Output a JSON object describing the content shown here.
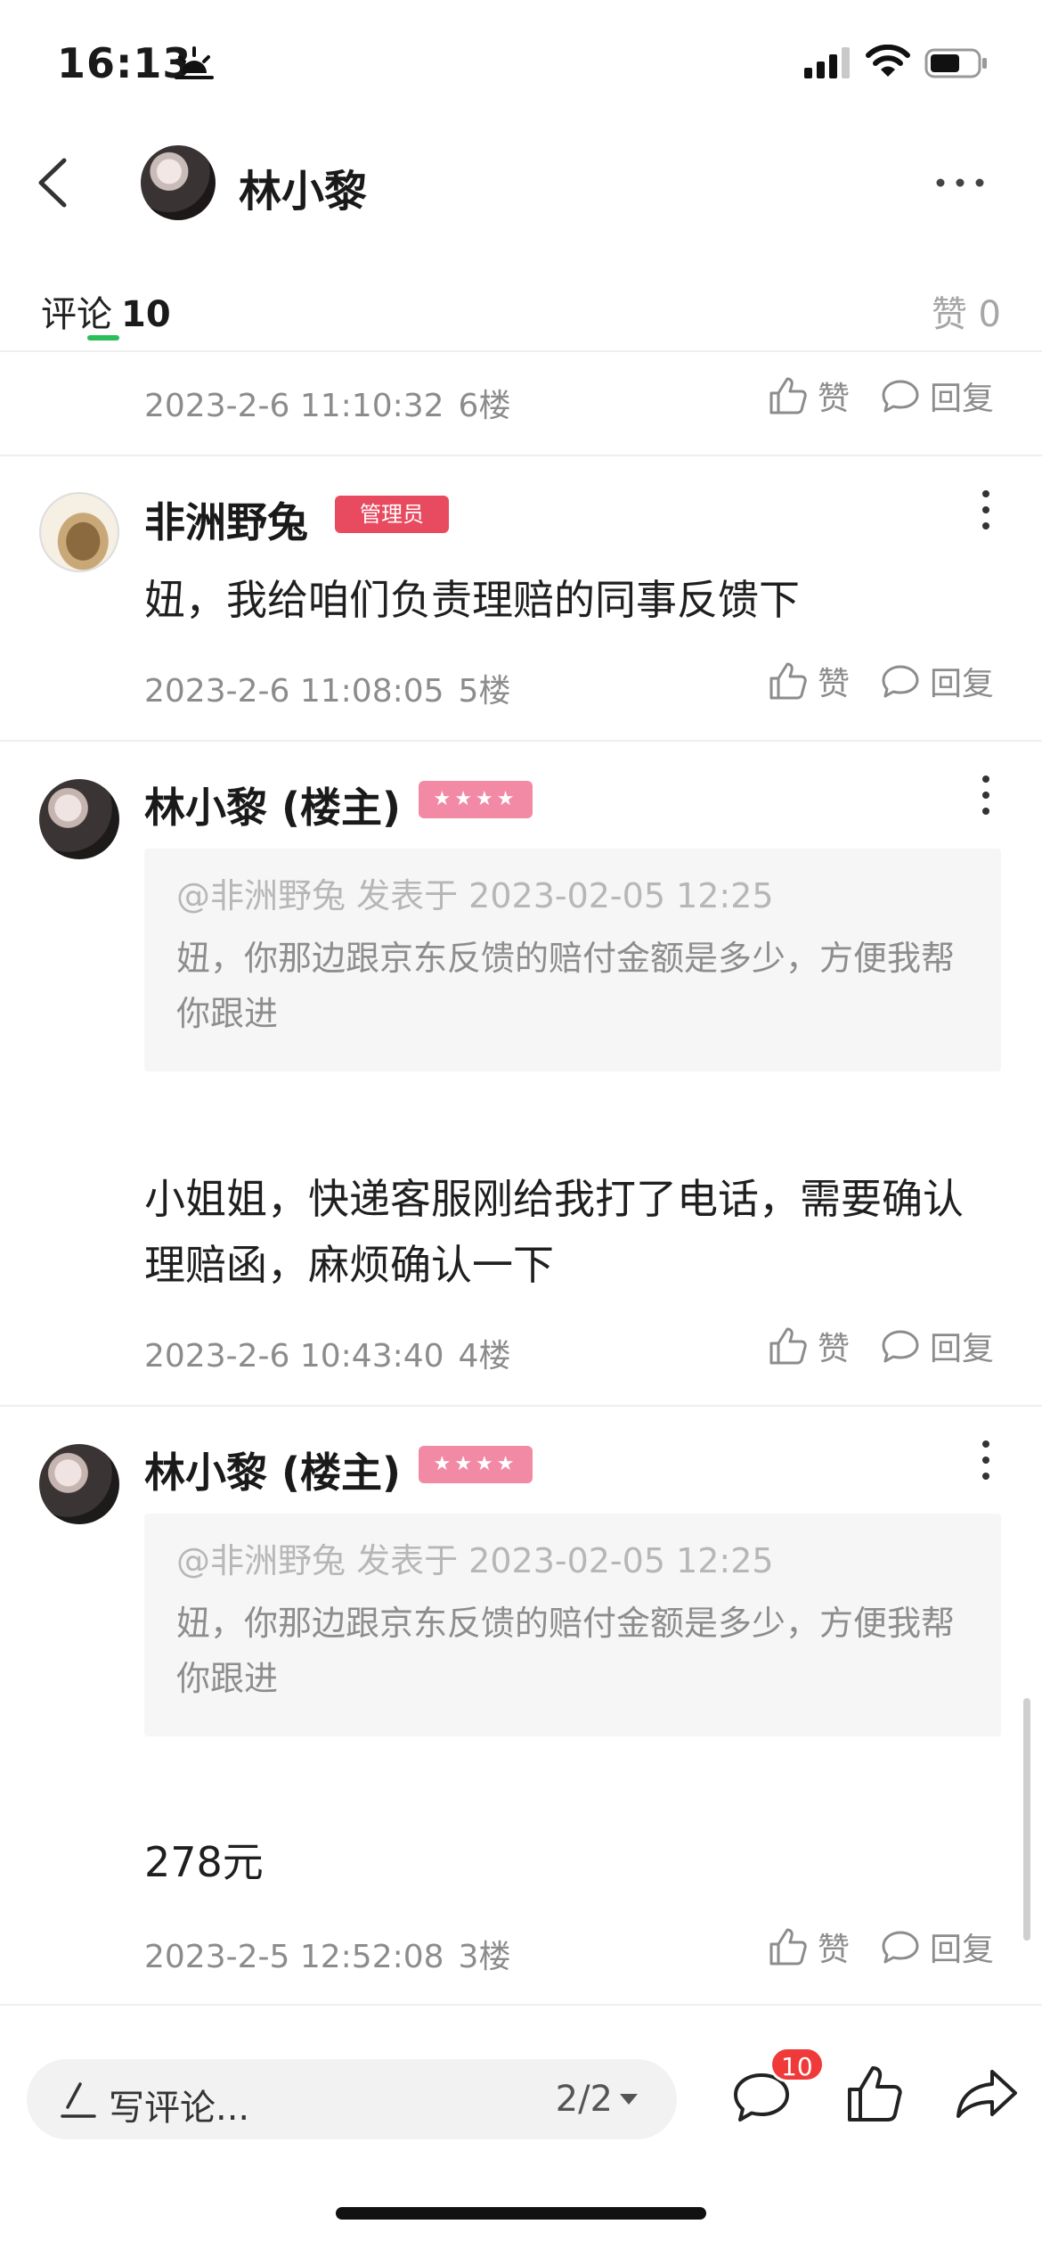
{
  "status_bar": {
    "time": "16:13"
  },
  "header": {
    "title": "林小黎"
  },
  "tabs": {
    "comments_label": "评论",
    "comments_count": "10",
    "likes_label": "赞 0"
  },
  "actions": {
    "like": "赞",
    "reply": "回复"
  },
  "comments": [
    {
      "time": "2023-2-6 11:10:32",
      "floor": "6楼"
    },
    {
      "author": "非洲野兔",
      "badge": "管理员",
      "text": "妞，我给咱们负责理赔的同事反馈下",
      "time": "2023-2-6 11:08:05",
      "floor": "5楼"
    },
    {
      "author": "林小黎 (楼主)",
      "badge": "★★★★",
      "quote_head": "@非洲野兔 发表于 2023-02-05 12:25",
      "quote_body": "妞，你那边跟京东反馈的赔付金额是多少，方便我帮你跟进",
      "text": "小姐姐，快递客服刚给我打了电话，需要确认理赔函，麻烦确认一下",
      "time": "2023-2-6 10:43:40",
      "floor": "4楼"
    },
    {
      "author": "林小黎 (楼主)",
      "badge": "★★★★",
      "quote_head": "@非洲野兔 发表于 2023-02-05 12:25",
      "quote_body": "妞，你那边跟京东反馈的赔付金额是多少，方便我帮你跟进",
      "text": "278元",
      "time": "2023-2-5 12:52:08",
      "floor": "3楼"
    }
  ],
  "bottom_bar": {
    "placeholder": "写评论...",
    "page": "2/2",
    "comment_badge": "10"
  },
  "colors": {
    "accent_green": "#2bbf5b",
    "admin_badge": "#e84a5f",
    "star_badge": "#f28aa6",
    "notify_red": "#f03a3a"
  }
}
